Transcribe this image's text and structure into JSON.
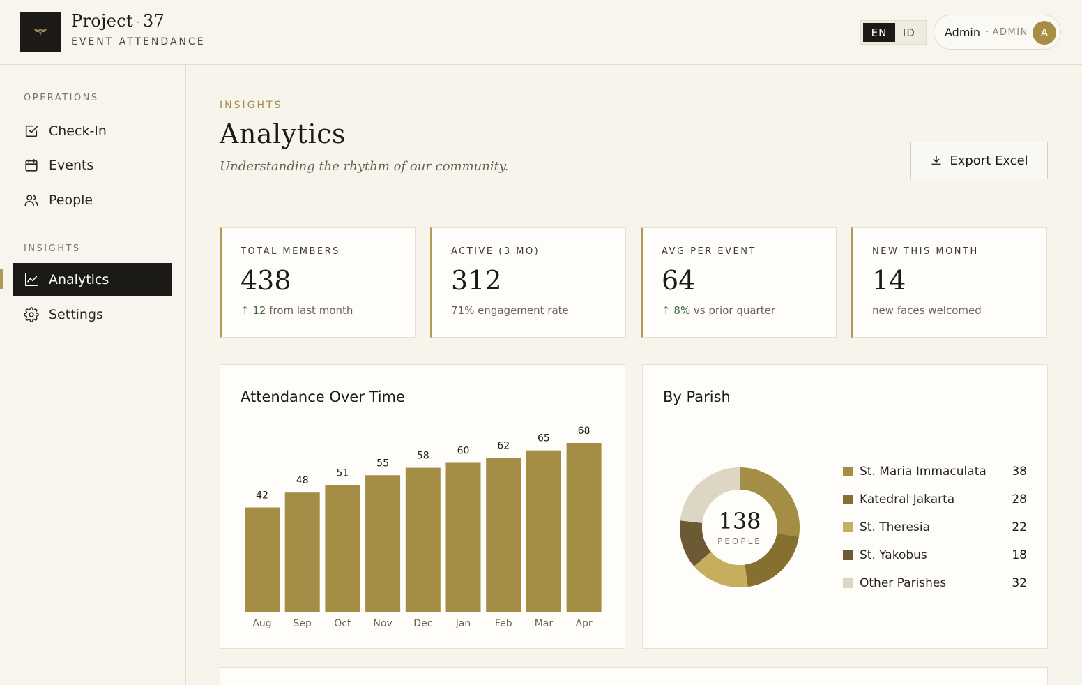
{
  "header": {
    "brand_name": "Project",
    "brand_number": "37",
    "brand_sep": "·",
    "brand_subtitle": "EVENT ATTENDANCE",
    "lang_active": "EN",
    "lang_inactive": "ID",
    "user_name": "Admin",
    "user_role": "ADMIN",
    "user_role_sep": "·",
    "avatar_letter": "A"
  },
  "sidebar": {
    "sections": [
      {
        "title": "OPERATIONS",
        "items": [
          {
            "label": "Check-In",
            "icon": "check-square-icon"
          },
          {
            "label": "Events",
            "icon": "calendar-icon"
          },
          {
            "label": "People",
            "icon": "people-icon"
          }
        ]
      },
      {
        "title": "INSIGHTS",
        "items": [
          {
            "label": "Analytics",
            "icon": "line-chart-icon",
            "active": true
          },
          {
            "label": "Settings",
            "icon": "gear-icon"
          }
        ]
      }
    ]
  },
  "page": {
    "eyebrow": "INSIGHTS",
    "title": "Analytics",
    "subtitle": "Understanding the rhythm of our community.",
    "export_label": "Export Excel"
  },
  "stats": [
    {
      "label": "TOTAL MEMBERS",
      "value": "438",
      "note_up": "↑ 12",
      "note": " from last month"
    },
    {
      "label": "ACTIVE (3 MO)",
      "value": "312",
      "note_up": "",
      "note": "71% engagement rate"
    },
    {
      "label": "AVG PER EVENT",
      "value": "64",
      "note_up": "↑ 8%",
      "note": " vs prior quarter"
    },
    {
      "label": "NEW THIS MONTH",
      "value": "14",
      "note_up": "",
      "note": "new faces welcomed"
    }
  ],
  "chart_data": [
    {
      "type": "bar",
      "title": "Attendance Over Time",
      "categories": [
        "Aug",
        "Sep",
        "Oct",
        "Nov",
        "Dec",
        "Jan",
        "Feb",
        "Mar",
        "Apr"
      ],
      "values": [
        42,
        48,
        51,
        55,
        58,
        60,
        62,
        65,
        68
      ],
      "ylim": [
        0,
        68
      ],
      "grid": false,
      "colors": {
        "bar": "#a48d44"
      }
    },
    {
      "type": "pie",
      "title": "By Parish",
      "center_value": "138",
      "center_label": "PEOPLE",
      "categories": [
        "St. Maria Immaculata",
        "Katedral Jakarta",
        "St. Theresia",
        "St. Yakobus",
        "Other Parishes"
      ],
      "values": [
        38,
        28,
        22,
        18,
        32
      ],
      "colors": [
        "#a48d44",
        "#857030",
        "#c7ad5e",
        "#6b5a34",
        "#ddd6c4"
      ],
      "legend": "right"
    }
  ]
}
